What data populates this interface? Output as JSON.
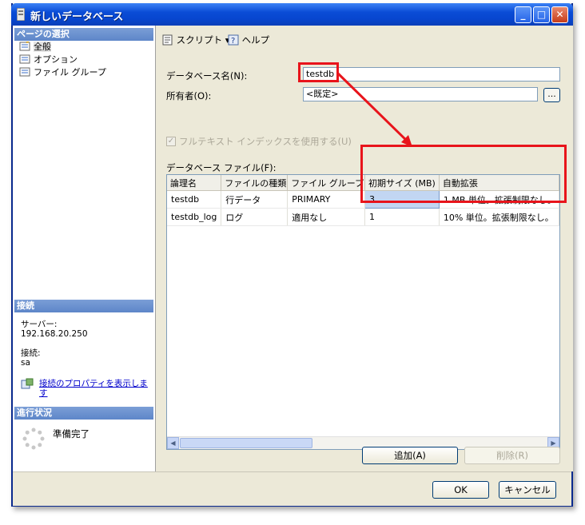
{
  "window": {
    "title": "新しいデータベース"
  },
  "left_panel": {
    "page_select_header": "ページの選択",
    "pages": [
      {
        "label": "全般",
        "selected": true
      },
      {
        "label": "オプション",
        "selected": false
      },
      {
        "label": "ファイル グループ",
        "selected": false
      }
    ],
    "connection_header": "接続",
    "server_label": "サーバー:",
    "server_value": "192.168.20.250",
    "connection_label": "接続:",
    "connection_value": "sa",
    "properties_link": "接続のプロパティを表示しま",
    "properties_link_wrap": "す",
    "progress_header": "進行状況",
    "progress_status": "準備完了"
  },
  "toolbar": {
    "script_label": "スクリプト ▾",
    "help_label": "ヘルプ"
  },
  "form": {
    "db_name_label": "データベース名(N):",
    "db_name_value": "testdb",
    "owner_label": "所有者(O):",
    "owner_value": "<既定>",
    "browse_label": "...",
    "fulltext_label": "フルテキスト インデックスを使用する(U)",
    "files_label": "データベース ファイル(F):"
  },
  "files_table": {
    "columns": [
      "論理名",
      "ファイルの種類",
      "ファイル グループ",
      "初期サイズ (MB)",
      "自動拡張"
    ],
    "rows": [
      {
        "name": "testdb",
        "type": "行データ",
        "filegroup": "PRIMARY",
        "size": "3",
        "autogrow": "1 MB 単位。拡張制限なし。"
      },
      {
        "name": "testdb_log",
        "type": "ログ",
        "filegroup": "適用なし",
        "size": "1",
        "autogrow": "10% 単位。拡張制限なし。"
      }
    ]
  },
  "buttons": {
    "add": "追加(A)",
    "remove": "削除(R)",
    "ok": "OK",
    "cancel": "キャンセル"
  },
  "colors": {
    "annotation": "#e8141b",
    "title_bar": "#0a4cd6",
    "section_header": "#6b8fcf"
  },
  "icons": [
    "db-icon",
    "page-icon",
    "script-icon",
    "help-icon",
    "server-icon",
    "spinner-icon",
    "close-icon",
    "minimize-icon",
    "maximize-icon"
  ]
}
